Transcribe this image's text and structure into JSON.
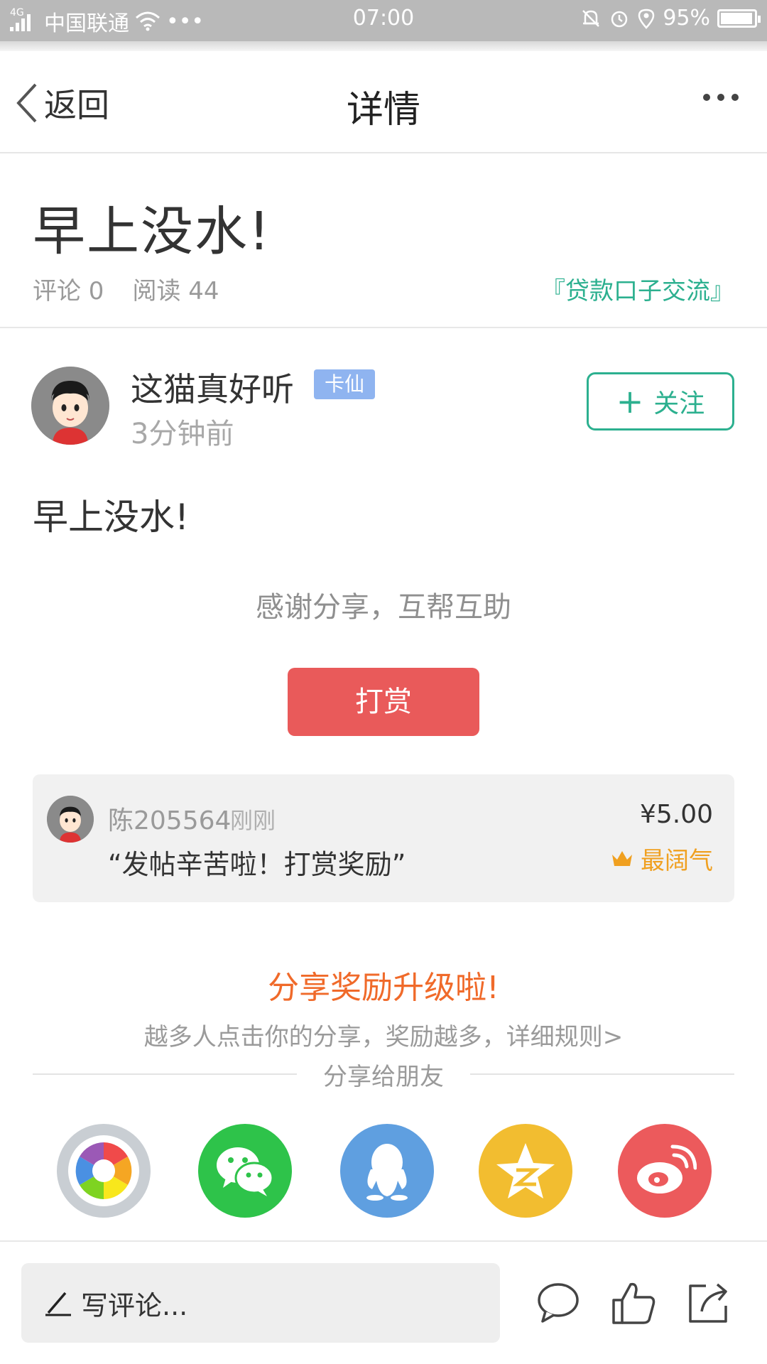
{
  "status_bar": {
    "network_type": "4G",
    "carrier": "中国联通",
    "dots": "•••",
    "time": "07:00",
    "battery": "95%",
    "battery_level": 0.95
  },
  "nav": {
    "back_label": "返回",
    "title": "详情"
  },
  "post": {
    "title": "早上没水!",
    "comments": "评论 0",
    "reads": "阅读 44",
    "forum": "『贷款口子交流』",
    "body": "早上没水!"
  },
  "author": {
    "name": "这猫真好听",
    "badge": "卡仙",
    "time": "3分钟前",
    "follow_label": "关注"
  },
  "reward": {
    "thanks_text": "感谢分享，互帮互助",
    "button_label": "打赏",
    "record": {
      "user": "陈205564",
      "time": "刚刚",
      "message": "“发帖辛苦啦！打赏奖励”",
      "amount": "¥5.00",
      "tag": "最阔气"
    }
  },
  "share": {
    "title": "分享奖励升级啦!",
    "subtitle": "越多人点击你的分享，奖励越多，详细规则>",
    "label": "分享给朋友",
    "targets": [
      {
        "icon": "moments-icon",
        "color": "#c9ced3"
      },
      {
        "icon": "wechat-icon",
        "color": "#2ec34a"
      },
      {
        "icon": "qq-icon",
        "color": "#5f9fe0"
      },
      {
        "icon": "qzone-icon",
        "color": "#f2bd30"
      },
      {
        "icon": "weibo-icon",
        "color": "#ec5a5c"
      }
    ]
  },
  "bottom_bar": {
    "comment_placeholder": "写评论..."
  },
  "colors": {
    "accent_green": "#2cb08f",
    "reward_red": "#e95a5a",
    "share_orange": "#f06a2a",
    "crown_gold": "#f0a020"
  }
}
